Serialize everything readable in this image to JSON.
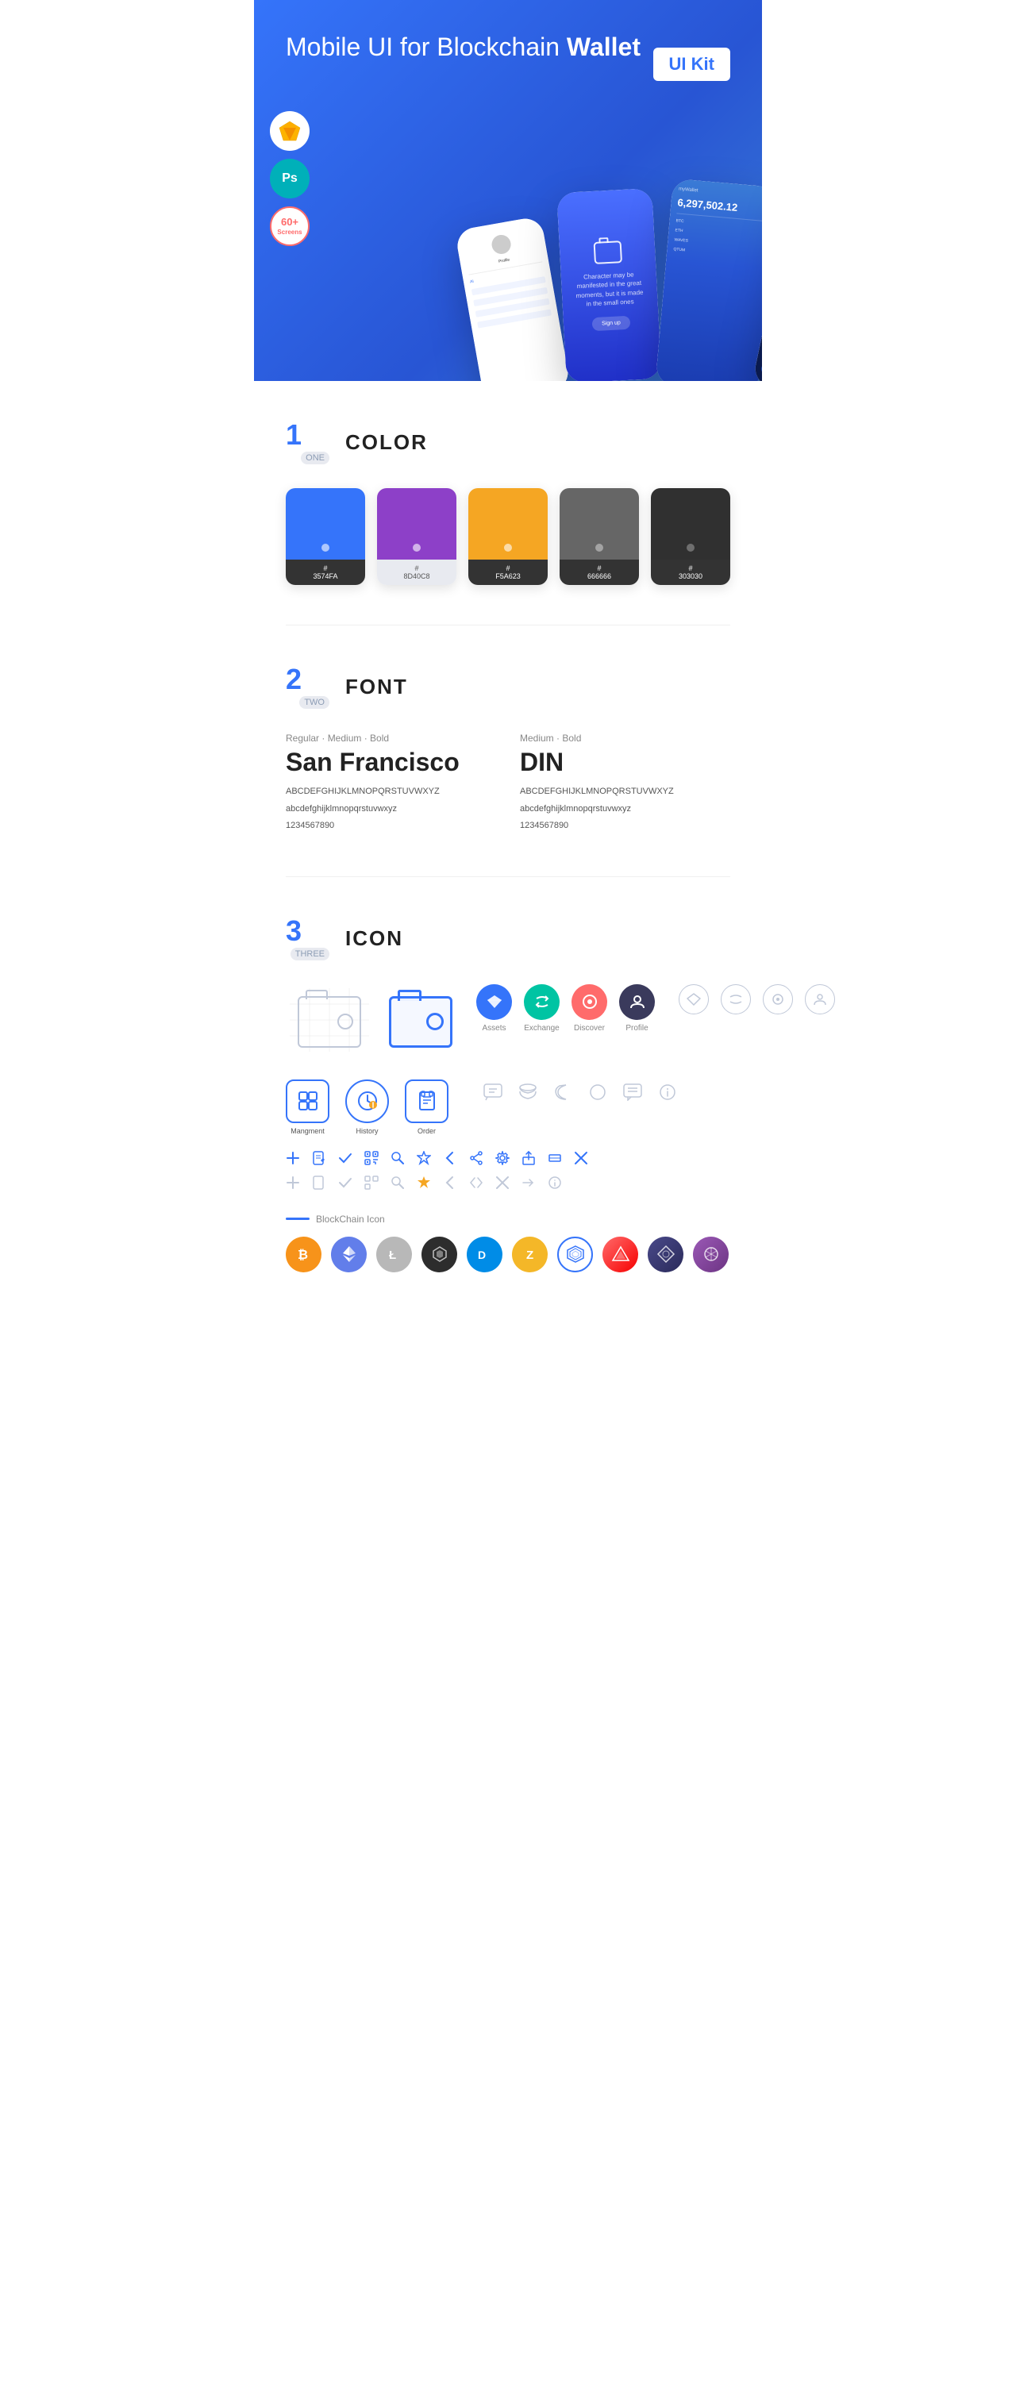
{
  "hero": {
    "title": "Mobile UI for Blockchain ",
    "title_bold": "Wallet",
    "ui_kit_label": "UI Kit",
    "badge_screens": "60+\nScreens",
    "sketch_icon": "🔶",
    "ps_label": "Ps"
  },
  "section1": {
    "number": "1",
    "number_label": "ONE",
    "title": "COLOR",
    "colors": [
      {
        "hex": "#3574FA",
        "code": "#\n3574FA",
        "dark": false
      },
      {
        "hex": "#8D40C8",
        "code": "#\n8D40C8",
        "dark": false
      },
      {
        "hex": "#F5A623",
        "code": "#\nF5A623",
        "dark": false
      },
      {
        "hex": "#666666",
        "code": "#\n666666",
        "dark": true
      },
      {
        "hex": "#303030",
        "code": "#\n303030",
        "dark": true
      }
    ]
  },
  "section2": {
    "number": "2",
    "number_label": "TWO",
    "title": "FONT",
    "fonts": [
      {
        "label": "Regular · Medium · Bold",
        "name": "San Francisco",
        "uppercase": "ABCDEFGHIJKLMNOPQRSTUVWXYZ",
        "lowercase": "abcdefghijklmnopqrstuvwxyz",
        "numbers": "1234567890"
      },
      {
        "label": "Medium · Bold",
        "name": "DIN",
        "uppercase": "ABCDEFGHIJKLMNOPQRSTUVWXYZ",
        "lowercase": "abcdefghijklmnopqrstuvwxyz",
        "numbers": "1234567890"
      }
    ]
  },
  "section3": {
    "number": "3",
    "number_label": "THREE",
    "title": "ICON",
    "nav_icons": [
      {
        "label": "Assets",
        "type": "circle-blue"
      },
      {
        "label": "Exchange",
        "type": "circle-teal"
      },
      {
        "label": "Discover",
        "type": "circle-red"
      },
      {
        "label": "Profile",
        "type": "circle-dark"
      }
    ],
    "app_icons": [
      {
        "label": "Mangment"
      },
      {
        "label": "History"
      },
      {
        "label": "Order"
      }
    ],
    "blockchain_label": "BlockChain Icon",
    "crypto_icons": [
      {
        "name": "BTC",
        "color": "#F7931A"
      },
      {
        "name": "ETH",
        "color": "#627EEA"
      },
      {
        "name": "LTC",
        "color": "#B8B8B8"
      },
      {
        "name": "BLK",
        "color": "#2D2D2D"
      },
      {
        "name": "DASH",
        "color": "#008CE7"
      },
      {
        "name": "ZEC",
        "color": "#F4B728"
      },
      {
        "name": "GEO",
        "color": "#3574FA"
      },
      {
        "name": "ARK",
        "color": "#F70000"
      },
      {
        "name": "POW",
        "color": "#3A3A6A"
      },
      {
        "name": "POA",
        "color": "#8B44AC"
      }
    ]
  }
}
